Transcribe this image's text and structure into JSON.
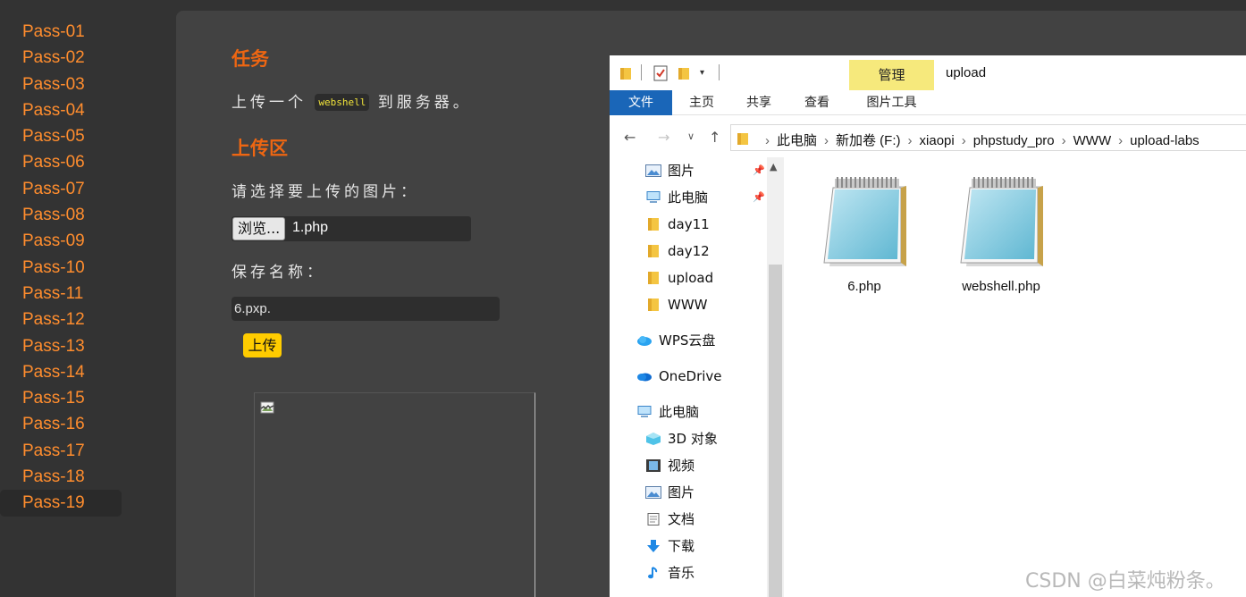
{
  "sidebar": {
    "items": [
      "Pass-01",
      "Pass-02",
      "Pass-03",
      "Pass-04",
      "Pass-05",
      "Pass-06",
      "Pass-07",
      "Pass-08",
      "Pass-09",
      "Pass-10",
      "Pass-11",
      "Pass-12",
      "Pass-13",
      "Pass-14",
      "Pass-15",
      "Pass-16",
      "Pass-17",
      "Pass-18",
      "Pass-19"
    ],
    "active": "Pass-19"
  },
  "main": {
    "task_heading": "任务",
    "task_text_before": "上传一个",
    "task_code": "webshell",
    "task_text_after": "到服务器。",
    "upload_heading": "上传区",
    "choose_label": "请选择要上传的图片：",
    "browse_label": "浏览...",
    "file_name": "1.php",
    "save_label": "保存名称：",
    "save_value": "6.pxp.",
    "upload_button": "上传"
  },
  "explorer": {
    "manage_tab": "管理",
    "title": "upload",
    "ribbon_tabs": [
      "文件",
      "主页",
      "共享",
      "查看",
      "图片工具"
    ],
    "breadcrumbs": [
      "此电脑",
      "新加卷 (F:)",
      "xiaopi",
      "phpstudy_pro",
      "WWW",
      "upload-labs"
    ],
    "nav_items": [
      {
        "label": "图片",
        "icon": "pictures-icon",
        "pinned": true
      },
      {
        "label": "此电脑",
        "icon": "computer-icon",
        "pinned": true
      },
      {
        "label": "day11",
        "icon": "folder-icon",
        "pinned": false
      },
      {
        "label": "day12",
        "icon": "folder-icon",
        "pinned": false
      },
      {
        "label": "upload",
        "icon": "folder-icon",
        "pinned": false
      },
      {
        "label": "WWW",
        "icon": "folder-icon",
        "pinned": false
      },
      {
        "label": "WPS云盘",
        "icon": "cloud-icon",
        "pinned": false
      },
      {
        "label": "OneDrive",
        "icon": "onedrive-icon",
        "pinned": false
      },
      {
        "label": "此电脑",
        "icon": "computer-icon",
        "pinned": false
      },
      {
        "label": "3D 对象",
        "icon": "3d-objects-icon",
        "pinned": false
      },
      {
        "label": "视频",
        "icon": "video-icon",
        "pinned": false
      },
      {
        "label": "图片",
        "icon": "pictures-icon",
        "pinned": false
      },
      {
        "label": "文档",
        "icon": "documents-icon",
        "pinned": false
      },
      {
        "label": "下载",
        "icon": "download-icon",
        "pinned": false
      },
      {
        "label": "音乐",
        "icon": "music-icon",
        "pinned": false
      }
    ],
    "files": [
      "6.php",
      "webshell.php"
    ]
  },
  "watermark": "CSDN @白菜炖粉条。",
  "colors": {
    "sidebar_link": "#ff8d2e",
    "heading": "#ee6612",
    "upload_button": "#ffcc00",
    "ribbon_file_tab": "#1a66b8",
    "manage_tab": "#f6e97c"
  }
}
